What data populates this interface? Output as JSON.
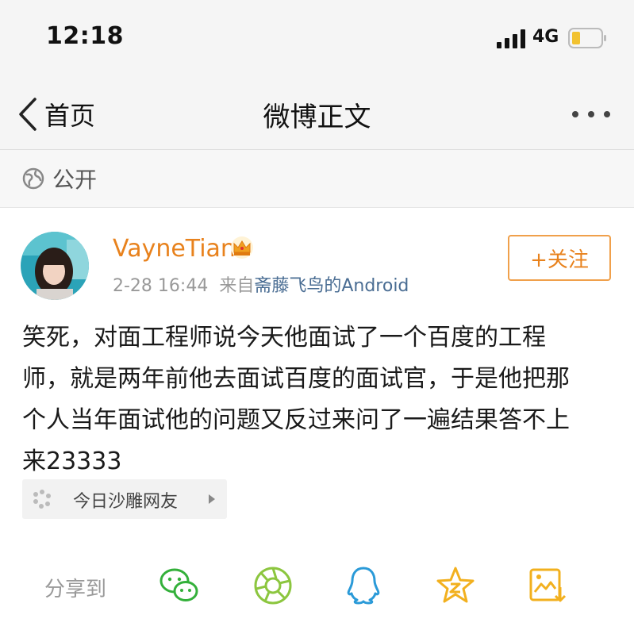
{
  "status": {
    "time": "12:18",
    "network": "4G"
  },
  "nav": {
    "back_label": "首页",
    "title": "微博正文"
  },
  "privacy": {
    "label": "公开"
  },
  "post": {
    "username": "VayneTian",
    "date": "2-28 16:44",
    "source_prefix": "来自",
    "source": "斋藤飞鸟的Android",
    "follow_label": "+关注",
    "text_lines": [
      "笑死，对面工程师说今天他面试了一个百度的工程",
      "师，就是两年前他去面试百度的面试官，于是他把那",
      "个人当年面试他的问题又反过来问了一遍结果答不上",
      "来23333"
    ],
    "topic": "今日沙雕网友"
  },
  "share": {
    "label": "分享到",
    "targets": [
      "wechat-icon",
      "moments-icon",
      "qq-icon",
      "qzone-icon",
      "save-image-icon"
    ]
  },
  "colors": {
    "accent": "#e8821d",
    "link": "#4a6d93",
    "wechat": "#33b03a",
    "qq": "#2a9ad8",
    "qzone": "#f2b01e"
  }
}
